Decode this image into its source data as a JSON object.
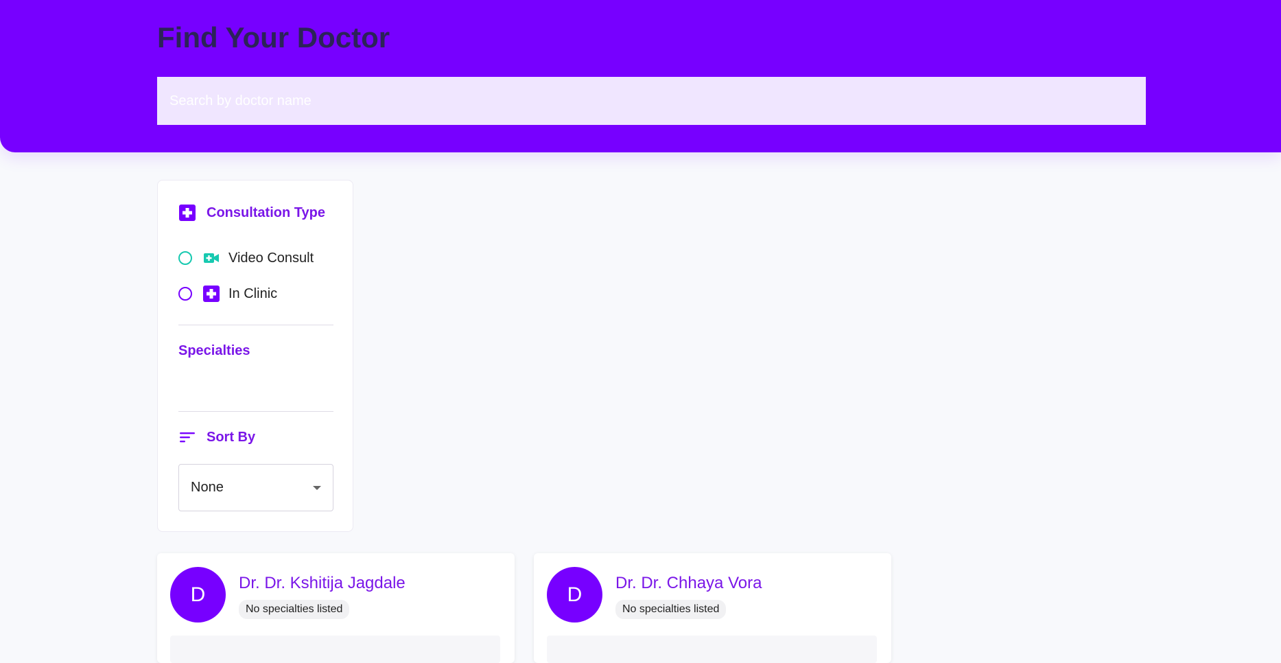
{
  "header": {
    "title": "Find Your Doctor",
    "search_placeholder": "Search by doctor name",
    "bg_color": "#7700ff"
  },
  "filters": {
    "consultation": {
      "title": "Consultation Type",
      "icon": "medical-plus-icon",
      "options": [
        {
          "label": "Video Consult",
          "icon": "video-plus-icon",
          "selected": false,
          "color": "#17c9b0"
        },
        {
          "label": "In Clinic",
          "icon": "clinic-plus-icon",
          "selected": false,
          "color": "#7700ff"
        }
      ]
    },
    "specialties": {
      "title": "Specialties"
    },
    "sort": {
      "title": "Sort By",
      "icon": "sort-lines-icon",
      "selected": "None"
    }
  },
  "doctors": [
    {
      "initial": "D",
      "name": "Dr. Dr. Kshitija Jagdale",
      "specialty": "No specialties listed"
    },
    {
      "initial": "D",
      "name": "Dr. Dr. Chhaya Vora",
      "specialty": "No specialties listed"
    }
  ]
}
